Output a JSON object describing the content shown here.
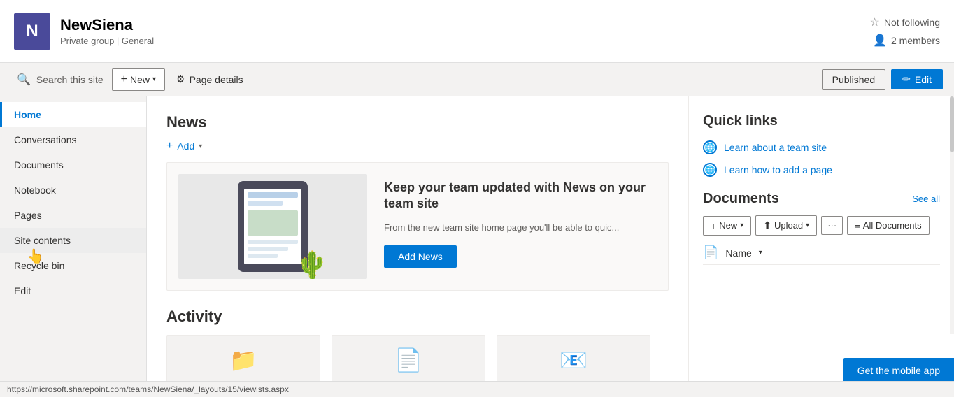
{
  "header": {
    "avatar_letter": "N",
    "site_name": "NewSiena",
    "site_meta": "Private group | General",
    "not_following_label": "Not following",
    "members_label": "2 members"
  },
  "toolbar": {
    "search_label": "Search this site",
    "new_label": "New",
    "page_details_label": "Page details",
    "published_label": "Published",
    "edit_label": "Edit"
  },
  "sidebar": {
    "items": [
      {
        "label": "Home",
        "active": true
      },
      {
        "label": "Conversations",
        "active": false
      },
      {
        "label": "Documents",
        "active": false
      },
      {
        "label": "Notebook",
        "active": false
      },
      {
        "label": "Pages",
        "active": false
      },
      {
        "label": "Site contents",
        "active": false,
        "hovered": true
      },
      {
        "label": "Recycle bin",
        "active": false
      },
      {
        "label": "Edit",
        "active": false
      }
    ]
  },
  "news": {
    "title": "News",
    "add_label": "Add",
    "headline": "Keep your team updated with News on your team site",
    "description": "From the new team site home page you'll be able to quic...",
    "add_news_label": "Add News"
  },
  "activity": {
    "title": "Activity"
  },
  "quick_links": {
    "title": "Quick links",
    "items": [
      {
        "label": "Learn about a team site"
      },
      {
        "label": "Learn how to add a page"
      }
    ]
  },
  "documents": {
    "title": "Documents",
    "see_all_label": "See all",
    "new_label": "New",
    "upload_label": "Upload",
    "more_label": "···",
    "all_documents_label": "All Documents",
    "name_column": "Name"
  },
  "status_bar": {
    "url": "https://microsoft.sharepoint.com/teams/NewSiena/_layouts/15/viewlsts.aspx"
  },
  "mobile_banner": {
    "label": "Get the mobile app"
  }
}
